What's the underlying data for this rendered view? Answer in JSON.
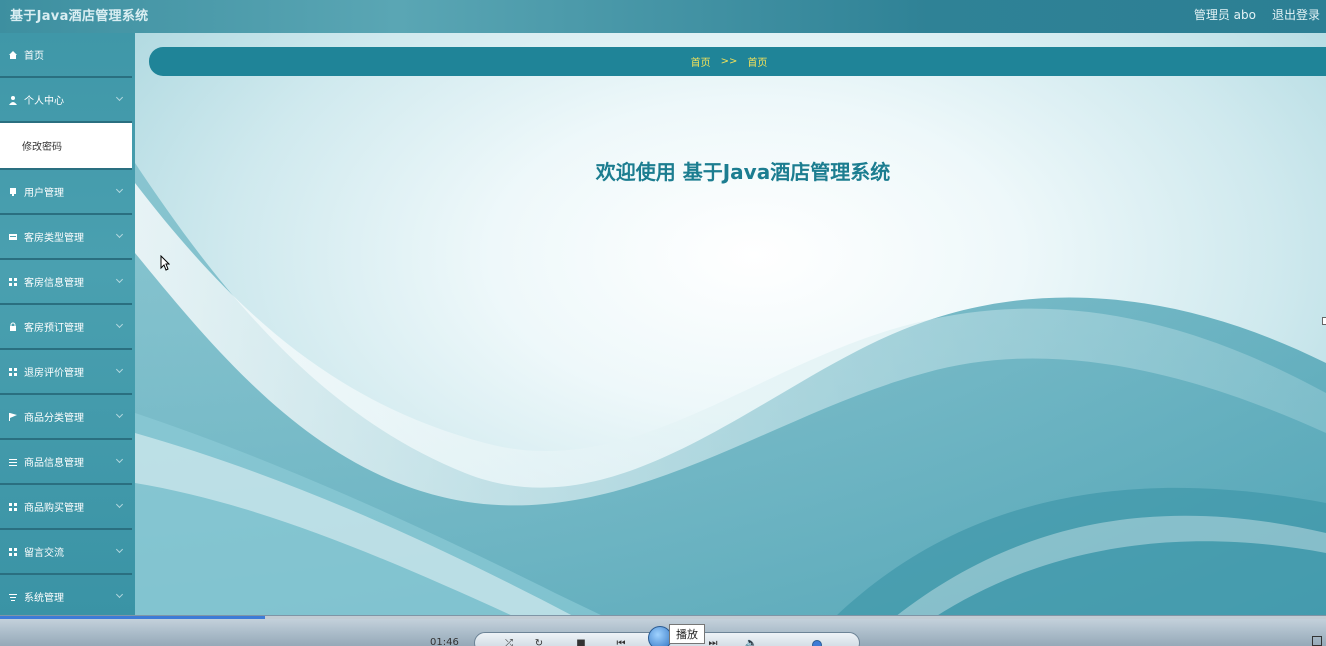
{
  "app": {
    "title": "基于Java酒店管理系统"
  },
  "header": {
    "user_label": "管理员 abo",
    "logout_label": "退出登录"
  },
  "sidebar": {
    "items": [
      {
        "label": "首页",
        "icon": "home-icon"
      },
      {
        "label": "个人中心",
        "icon": "person-icon",
        "expanded": true,
        "sub": "修改密码"
      },
      {
        "label": "用户管理",
        "icon": "user-icon"
      },
      {
        "label": "客房类型管理",
        "icon": "card-icon"
      },
      {
        "label": "客房信息管理",
        "icon": "grid-icon"
      },
      {
        "label": "客房预订管理",
        "icon": "lock-icon"
      },
      {
        "label": "退房评价管理",
        "icon": "grid-icon"
      },
      {
        "label": "商品分类管理",
        "icon": "flag-icon"
      },
      {
        "label": "商品信息管理",
        "icon": "list-icon"
      },
      {
        "label": "商品购买管理",
        "icon": "grid-icon"
      },
      {
        "label": "留言交流",
        "icon": "grid-icon"
      },
      {
        "label": "系统管理",
        "icon": "sliders-icon"
      }
    ]
  },
  "breadcrumb": {
    "first": "首页",
    "separator": ">>",
    "current": "首页"
  },
  "main": {
    "welcome": "欢迎使用 基于Java酒店管理系统"
  },
  "player": {
    "time": "01:46",
    "tooltip": "播放",
    "progress_fraction": 0.2
  },
  "colors": {
    "header": "#2c7f94",
    "sidebar": "#4aa0b0",
    "breadcrumb_bg": "#1f8498",
    "breadcrumb_text": "#f3e25a",
    "welcome_text": "#1c7d90"
  }
}
